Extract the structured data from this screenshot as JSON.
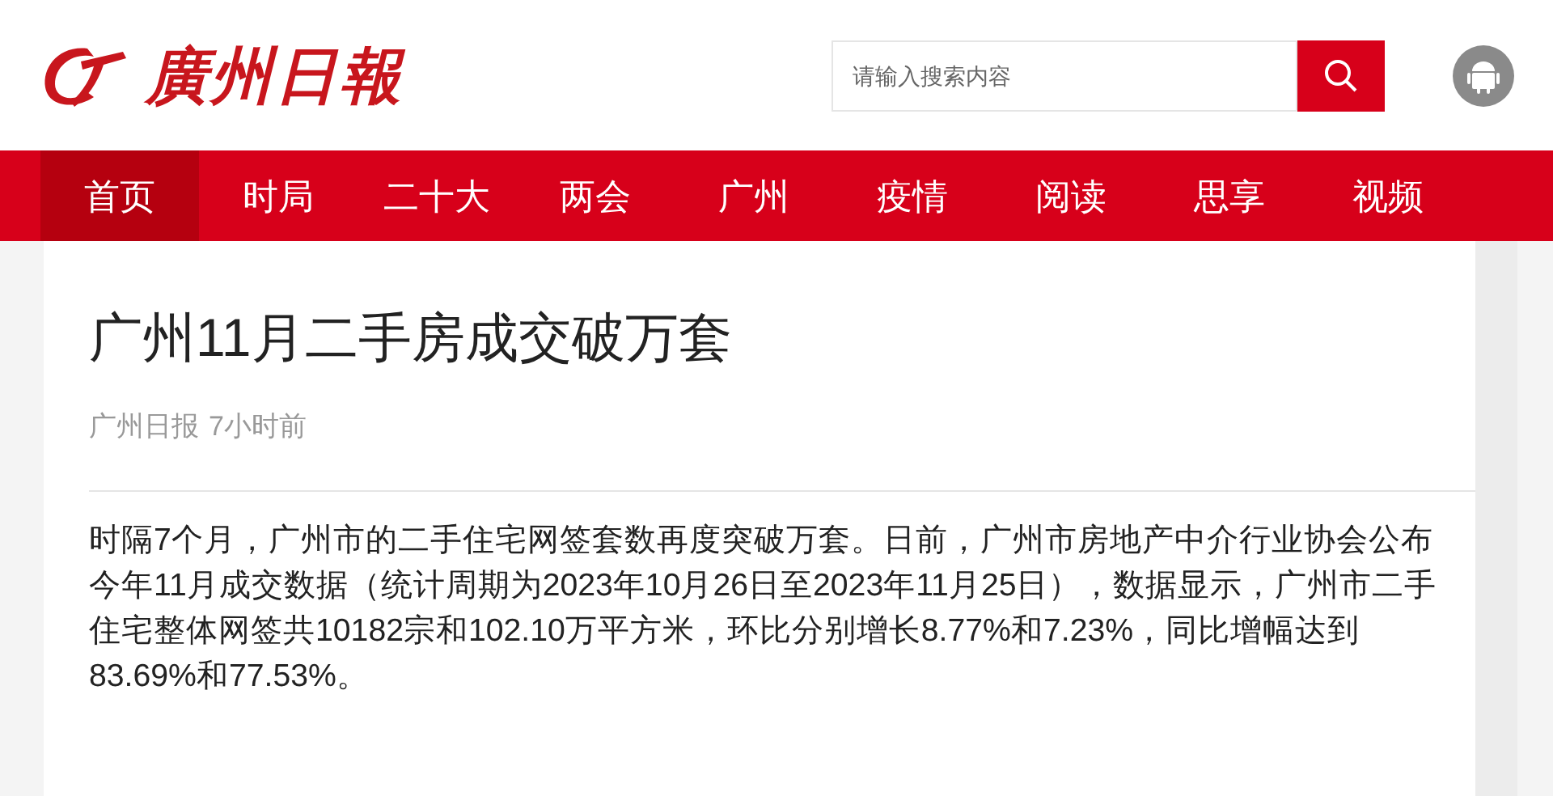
{
  "header": {
    "logo_text": "廣州日報",
    "search": {
      "placeholder": "请输入搜索内容"
    }
  },
  "nav": [
    {
      "label": "首页",
      "selected": true
    },
    {
      "label": "时局",
      "selected": false
    },
    {
      "label": "二十大",
      "selected": false
    },
    {
      "label": "两会",
      "selected": false
    },
    {
      "label": "广州",
      "selected": false
    },
    {
      "label": "疫情",
      "selected": false
    },
    {
      "label": "阅读",
      "selected": false
    },
    {
      "label": "思享",
      "selected": false
    },
    {
      "label": "视频",
      "selected": false
    }
  ],
  "article": {
    "title": "广州11月二手房成交破万套",
    "source": "广州日报",
    "time": "7小时前",
    "paragraphs": [
      "时隔7个月，广州市的二手住宅网签套数再度突破万套。日前，广州市房地产中介行业协会公布今年11月成交数据（统计周期为2023年10月26日至2023年11月25日），数据显示，广州市二手住宅整体网签共10182宗和102.10万平方米，环比分别增长8.77%和7.23%，同比增幅达到83.69%和77.53%。"
    ]
  }
}
